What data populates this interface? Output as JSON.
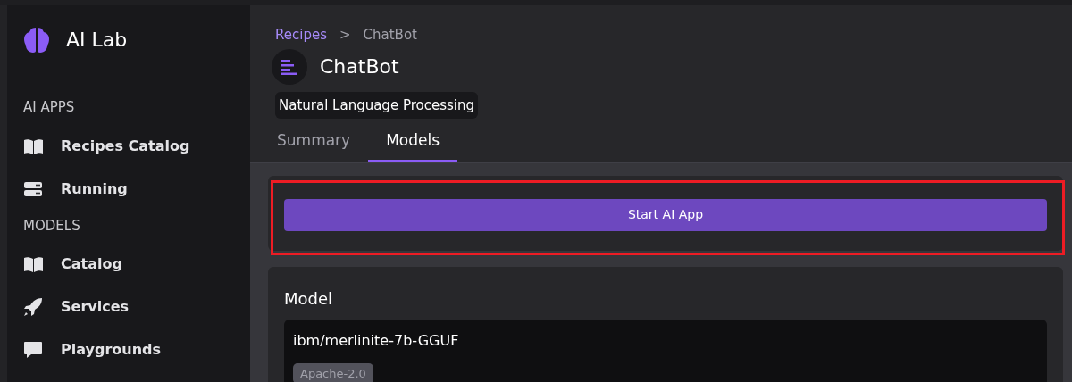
{
  "app": {
    "title": "AI Lab"
  },
  "sidebar": {
    "sections": [
      {
        "heading": "AI APPS",
        "items": [
          {
            "label": "Recipes Catalog",
            "selected": false
          },
          {
            "label": "Running",
            "selected": false
          }
        ]
      },
      {
        "heading": "MODELS",
        "items": [
          {
            "label": "Catalog",
            "selected": false
          },
          {
            "label": "Services",
            "selected": false
          },
          {
            "label": "Playgrounds",
            "selected": false
          }
        ]
      }
    ]
  },
  "breadcrumb": {
    "link": "Recipes",
    "separator": ">",
    "current": "ChatBot"
  },
  "header": {
    "title": "ChatBot",
    "tag": "Natural Language Processing"
  },
  "tabs": [
    {
      "label": "Summary",
      "selected": false
    },
    {
      "label": "Models",
      "selected": true
    }
  ],
  "action": {
    "label": "Start AI App",
    "highlighted": true
  },
  "model_card": {
    "heading": "Model",
    "name": "ibm/merlinite-7b-GGUF",
    "license": "Apache-2.0"
  }
}
